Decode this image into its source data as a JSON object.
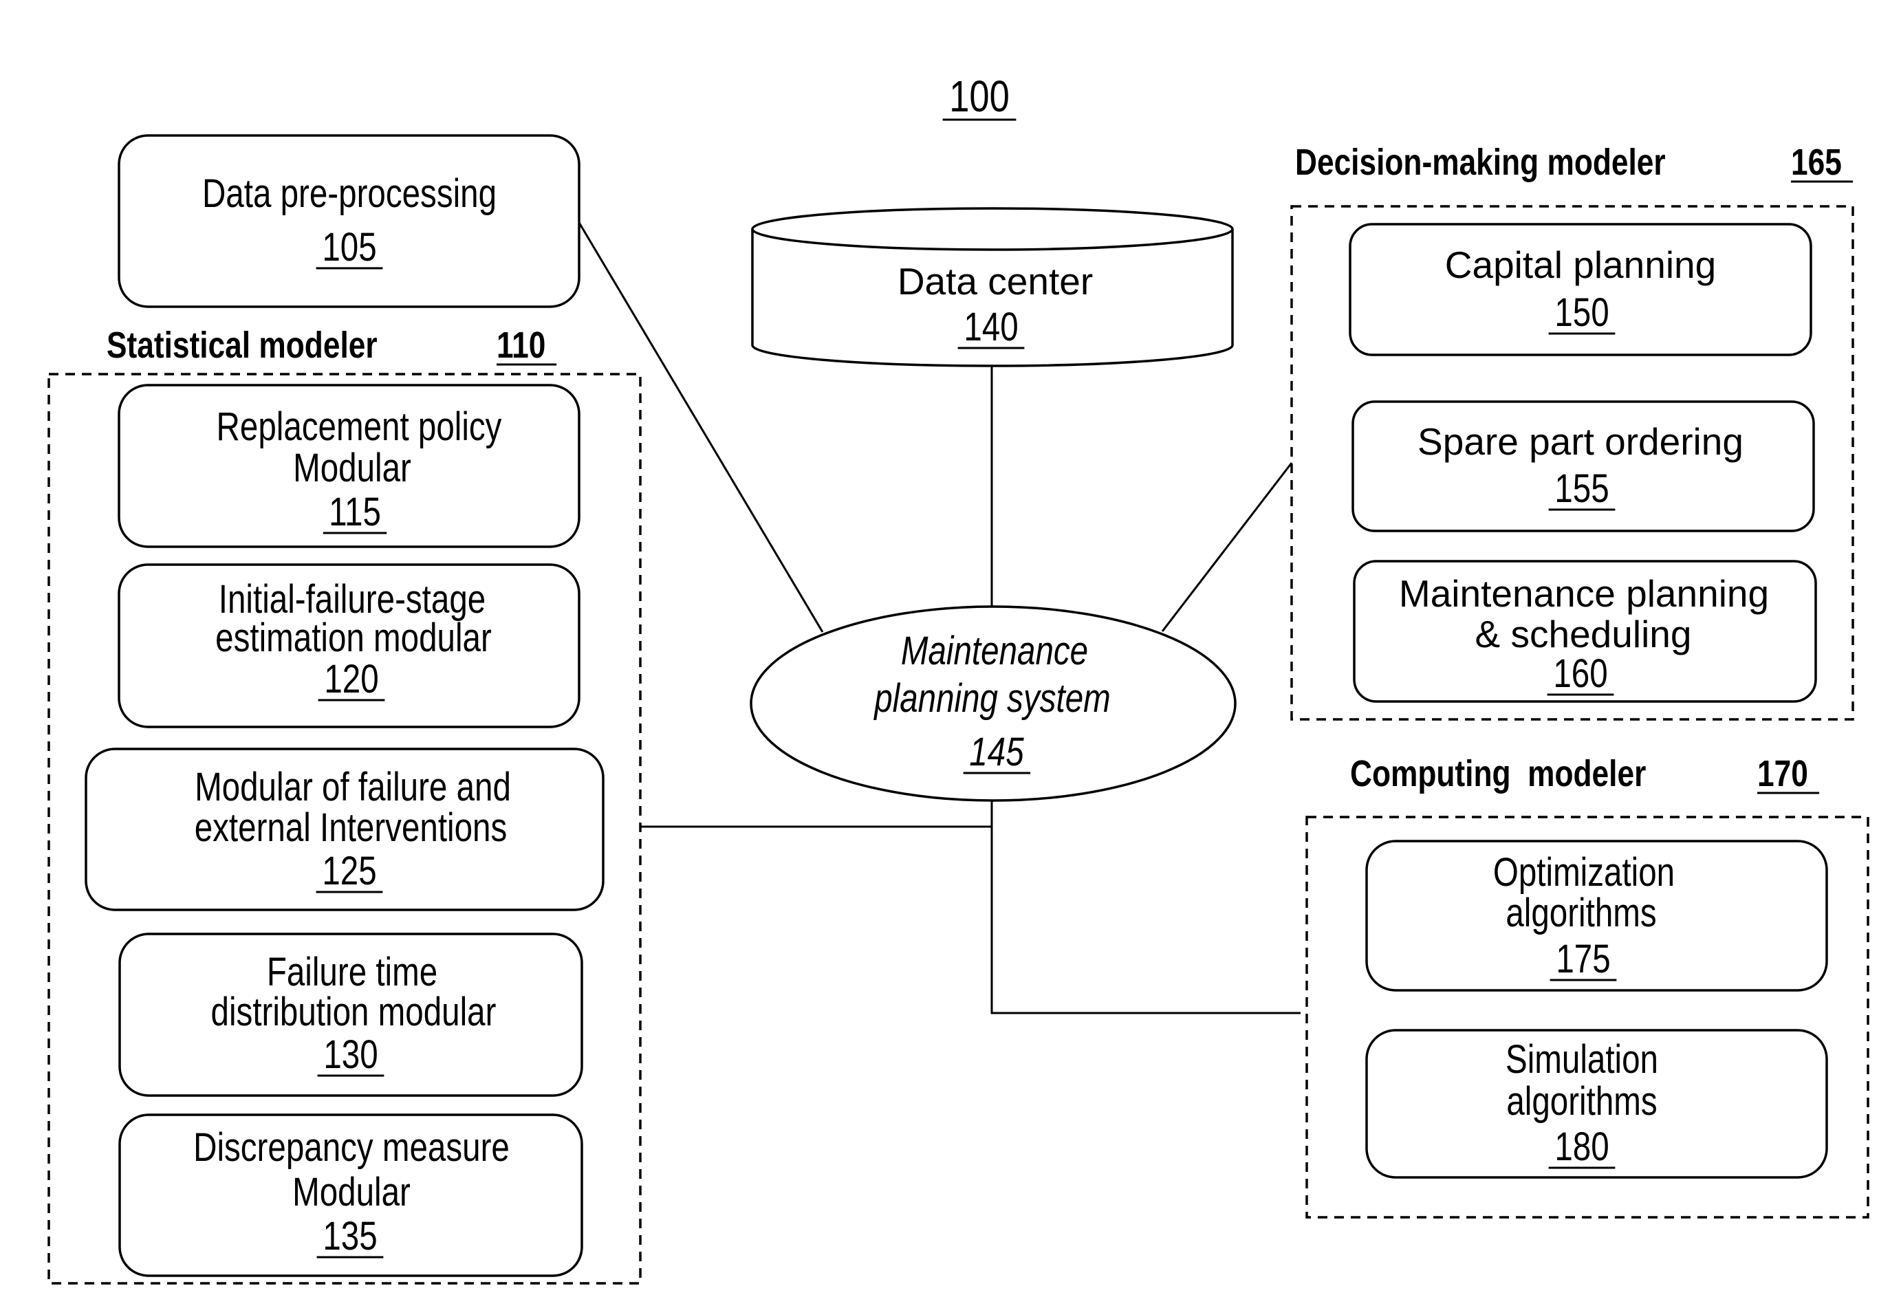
{
  "figure": {
    "ref": "100"
  },
  "data_preprocessing": {
    "lines": [
      "Data pre-processing"
    ],
    "ref": "105"
  },
  "statistical_modeler": {
    "title": "Statistical modeler",
    "ref": "110",
    "modules": [
      {
        "lines": [
          "Replacement policy",
          "Modular"
        ],
        "ref": "115"
      },
      {
        "lines": [
          "Initial-failure-stage",
          "estimation modular"
        ],
        "ref": "120"
      },
      {
        "lines": [
          "Modular of failure and",
          "external Interventions"
        ],
        "ref": "125"
      },
      {
        "lines": [
          "Failure time",
          "distribution modular"
        ],
        "ref": "130"
      },
      {
        "lines": [
          "Discrepancy measure",
          "Modular"
        ],
        "ref": "135"
      }
    ]
  },
  "data_center": {
    "lines": [
      "Data center"
    ],
    "ref": "140"
  },
  "maintenance_planning_system": {
    "lines": [
      "Maintenance",
      "planning system"
    ],
    "ref": "145"
  },
  "decision_making_modeler": {
    "title": "Decision-making modeler",
    "ref": "165",
    "modules": [
      {
        "lines": [
          "Capital planning"
        ],
        "ref": "150"
      },
      {
        "lines": [
          "Spare part ordering"
        ],
        "ref": "155"
      },
      {
        "lines": [
          "Maintenance planning",
          "& scheduling"
        ],
        "ref": "160"
      }
    ]
  },
  "computing_modeler": {
    "title": "Computing  modeler",
    "ref": "170",
    "modules": [
      {
        "lines": [
          "Optimization",
          "algorithms"
        ],
        "ref": "175"
      },
      {
        "lines": [
          "Simulation",
          "algorithms"
        ],
        "ref": "180"
      }
    ]
  }
}
